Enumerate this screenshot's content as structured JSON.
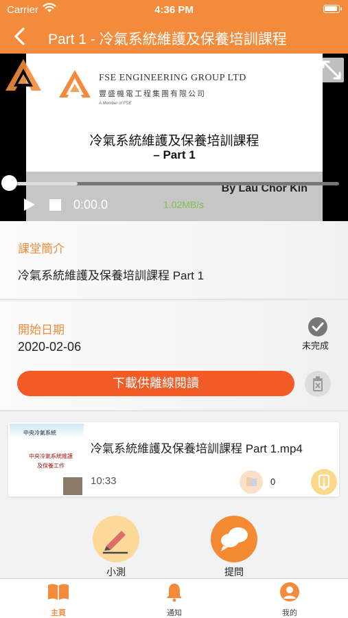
{
  "status_bar": {
    "carrier": "Carrier",
    "time": "4:36 PM"
  },
  "nav": {
    "title": "Part 1 - 冷氣系統維護及保養培訓課程"
  },
  "player": {
    "slide_company_en": "FSE ENGINEERING GROUP LTD",
    "slide_company_zh": "豐盛機電工程集團有限公司",
    "slide_member": "A Member of FSE",
    "slide_title": "冷氣系統維護及保養培訓課程",
    "slide_part": "– Part 1",
    "slide_lecturer": "By Lau Chor Kin",
    "time": "0:00.0",
    "speed": "1.02MB/s",
    "buffered_fraction": 0.21
  },
  "intro": {
    "label": "課堂簡介",
    "text": "冷氣系統維護及保養培訓課程  Part 1"
  },
  "schedule": {
    "label": "開始日期",
    "date": "2020-02-06",
    "status": "未完成",
    "download_label": "下載供離線閱讀"
  },
  "video_item": {
    "title": "冷氣系統維護及保養培訓課程  Part 1.mp4",
    "duration": "10:33",
    "views": "0",
    "thumb_header": "中央冷氣系統",
    "thumb_line1": "中央冷氣系統維護",
    "thumb_line2": "及保養工作"
  },
  "actions": {
    "quiz_label": "小測",
    "ask_label": "提問"
  },
  "tabs": [
    {
      "label": "主頁"
    },
    {
      "label": "通知"
    },
    {
      "label": "我的"
    }
  ],
  "colors": {
    "accent": "#f28c3c",
    "download": "#f25a26",
    "active_tab": "#f28c3c"
  }
}
